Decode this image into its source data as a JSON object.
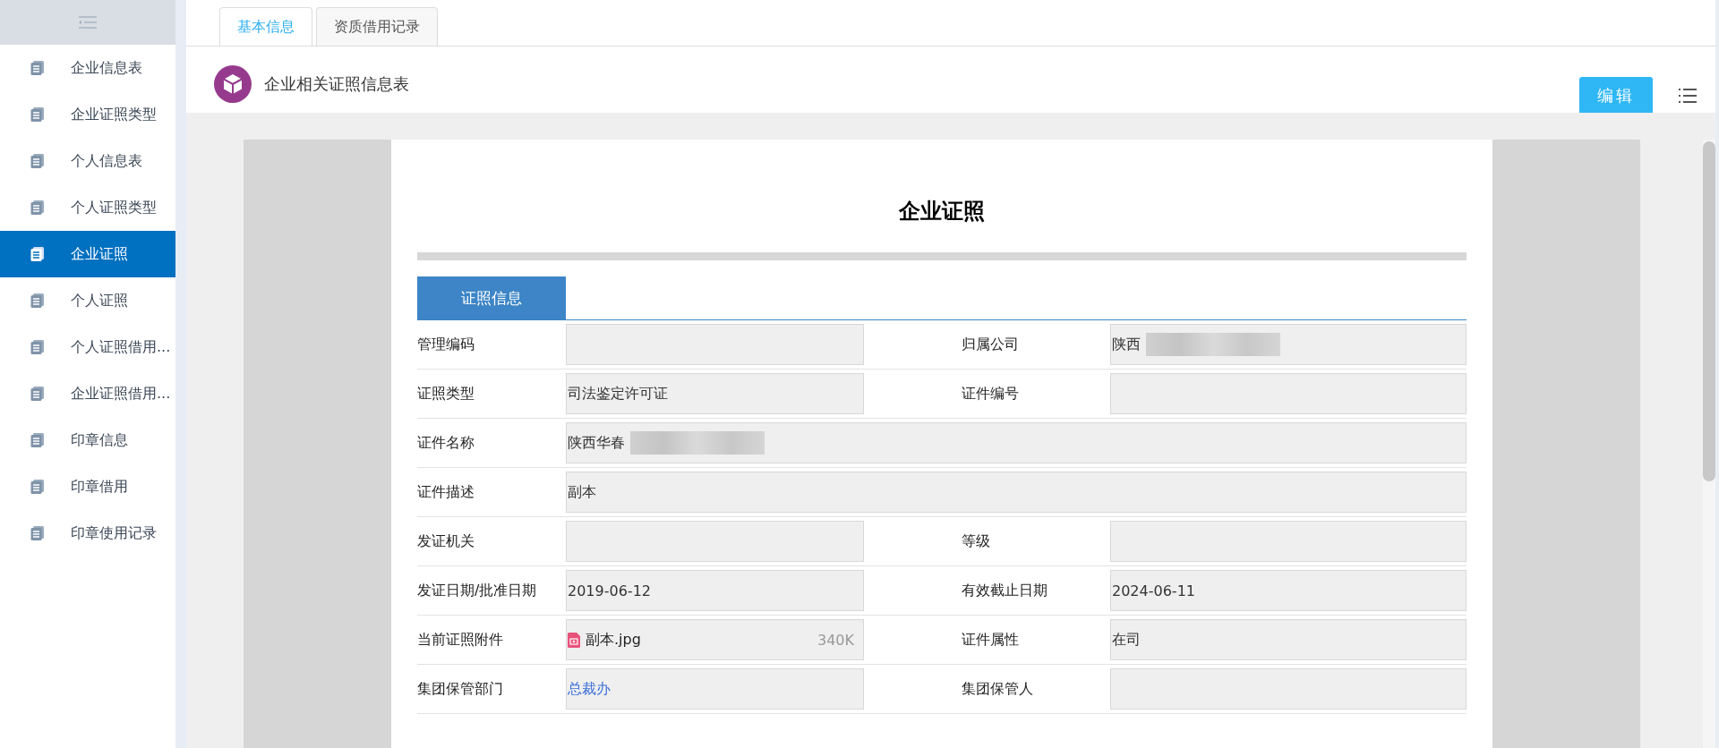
{
  "sidebar": {
    "items": [
      {
        "label": "企业信息表",
        "selected": false
      },
      {
        "label": "企业证照类型",
        "selected": false
      },
      {
        "label": "个人信息表",
        "selected": false
      },
      {
        "label": "个人证照类型",
        "selected": false
      },
      {
        "label": "企业证照",
        "selected": true
      },
      {
        "label": "个人证照",
        "selected": false
      },
      {
        "label": "个人证照借用...",
        "selected": false
      },
      {
        "label": "企业证照借用...",
        "selected": false
      },
      {
        "label": "印章信息",
        "selected": false
      },
      {
        "label": "印章借用",
        "selected": false
      },
      {
        "label": "印章使用记录",
        "selected": false
      }
    ]
  },
  "tabs": [
    {
      "label": "基本信息",
      "selected": true
    },
    {
      "label": "资质借用记录",
      "selected": false
    }
  ],
  "header": {
    "title": "企业相关证照信息表",
    "edit_button": "编辑"
  },
  "document": {
    "title": "企业证照",
    "section_tab": "证照信息",
    "rows": [
      {
        "fields": [
          {
            "label": "管理编码",
            "kind": "text"
          },
          {
            "label": "归属公司",
            "kind": "redacted",
            "value": "陕西"
          }
        ]
      },
      {
        "fields": [
          {
            "label": "证照类型",
            "kind": "text",
            "value": "司法鉴定许可证"
          },
          {
            "label": "证件编号",
            "kind": "text"
          }
        ]
      },
      {
        "fields": [
          {
            "label": "证件名称",
            "kind": "redacted",
            "value": "陕西华春"
          }
        ]
      },
      {
        "fields": [
          {
            "label": "证件描述",
            "kind": "text",
            "value": "副本"
          }
        ]
      },
      {
        "fields": [
          {
            "label": "发证机关",
            "kind": "text"
          },
          {
            "label": "等级",
            "kind": "text"
          }
        ]
      },
      {
        "fields": [
          {
            "label": "发证日期/批准日期",
            "kind": "text",
            "value": "2019-06-12"
          },
          {
            "label": "有效截止日期",
            "kind": "text",
            "value": "2024-06-11"
          }
        ]
      },
      {
        "fields": [
          {
            "label": "当前证照附件",
            "kind": "file",
            "value": "副本.jpg",
            "size": "340K"
          },
          {
            "label": "证件属性",
            "kind": "text",
            "value": "在司"
          }
        ]
      },
      {
        "fields": [
          {
            "label": "集团保管部门",
            "kind": "link",
            "value": "总裁办"
          },
          {
            "label": "集团保管人",
            "kind": "text"
          }
        ]
      }
    ]
  }
}
